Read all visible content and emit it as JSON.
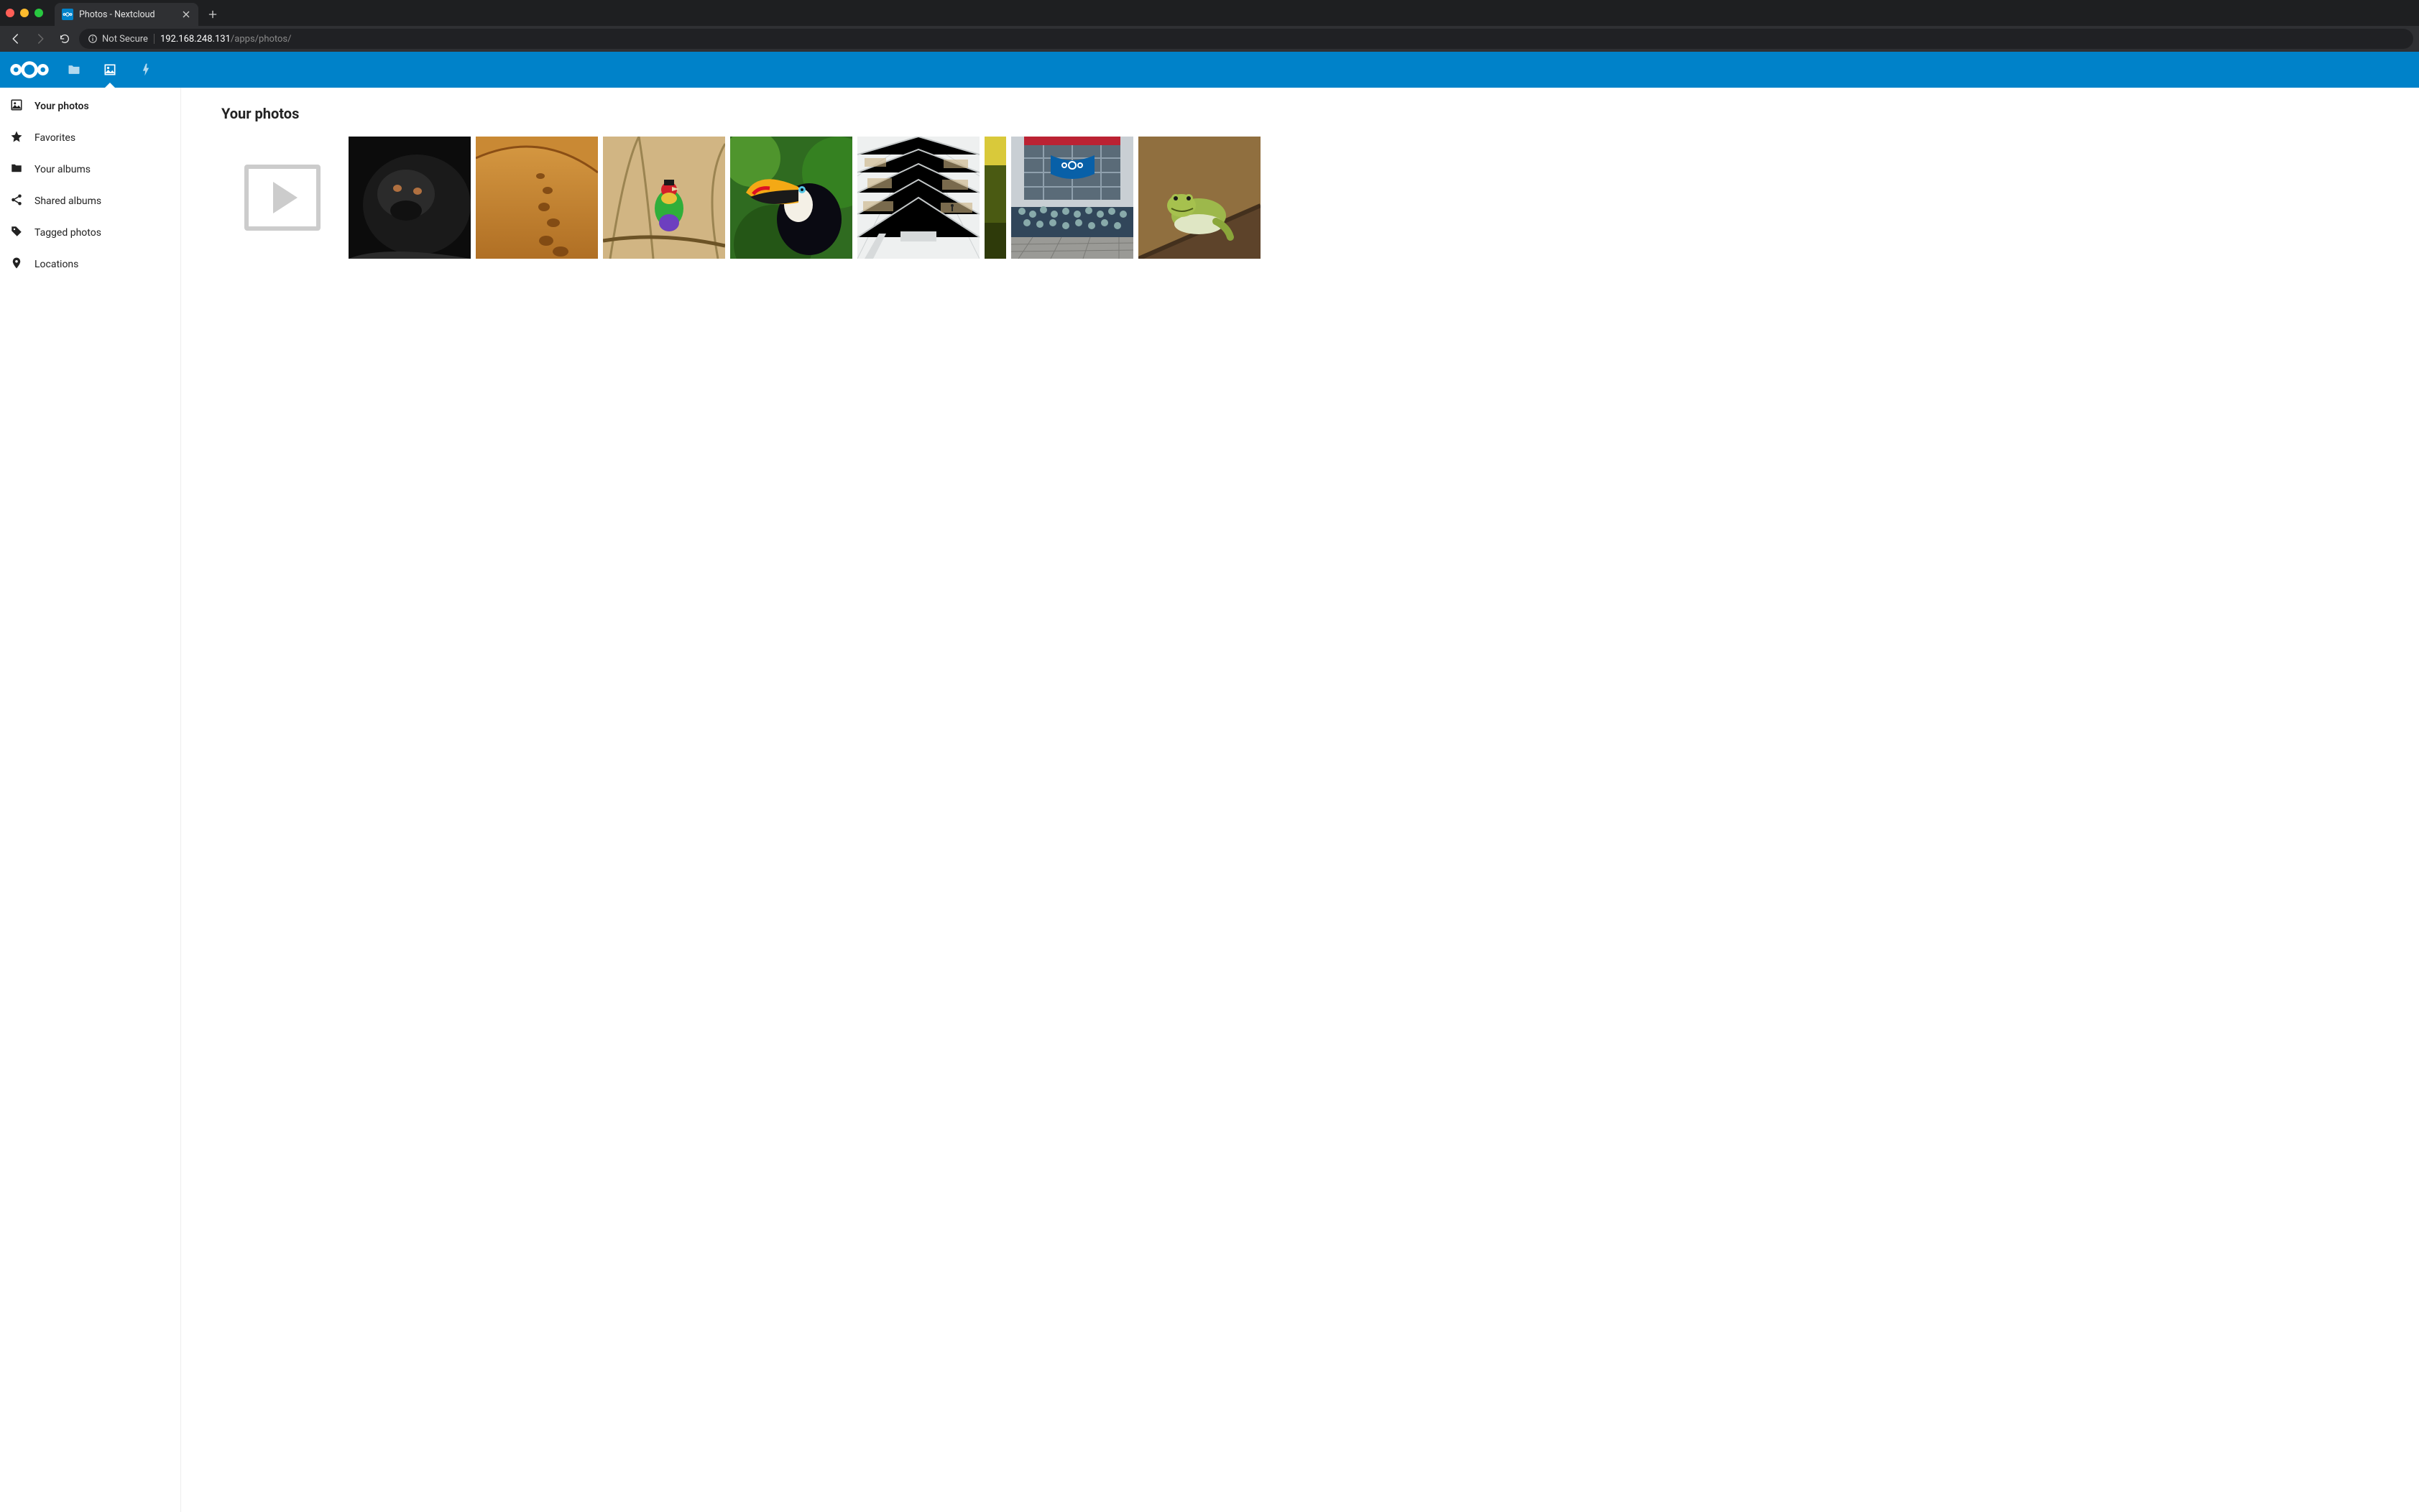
{
  "browser": {
    "tab_title": "Photos - Nextcloud",
    "security_label": "Not Secure",
    "url_host": "192.168.248.131",
    "url_path": "/apps/photos/"
  },
  "header_apps": {
    "files": "Files",
    "photos": "Photos",
    "activity": "Activity"
  },
  "sidebar": {
    "items": [
      {
        "label": "Your photos",
        "icon": "image-icon"
      },
      {
        "label": "Favorites",
        "icon": "star-icon"
      },
      {
        "label": "Your albums",
        "icon": "folder-icon"
      },
      {
        "label": "Shared albums",
        "icon": "share-icon"
      },
      {
        "label": "Tagged photos",
        "icon": "tag-icon"
      },
      {
        "label": "Locations",
        "icon": "location-icon"
      }
    ]
  },
  "page": {
    "title": "Your photos"
  },
  "photos": [
    {
      "name": "video-placeholder",
      "type": "video"
    },
    {
      "name": "gorilla"
    },
    {
      "name": "desert-steps"
    },
    {
      "name": "finch-bird"
    },
    {
      "name": "toucan"
    },
    {
      "name": "library"
    },
    {
      "name": "nature-crop"
    },
    {
      "name": "nextcloud-community"
    },
    {
      "name": "frog"
    }
  ]
}
